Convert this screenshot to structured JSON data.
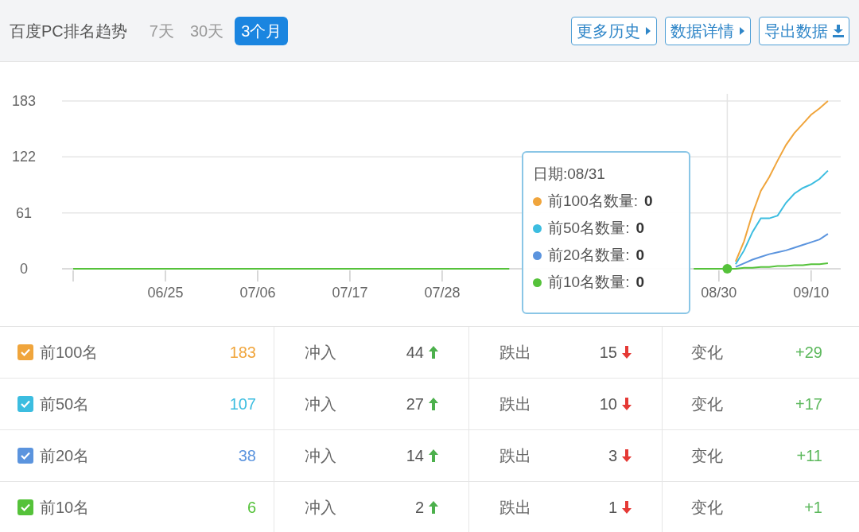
{
  "header": {
    "title": "百度PC排名趋势",
    "ranges": [
      {
        "label": "7天",
        "selected": false
      },
      {
        "label": "30天",
        "selected": false
      },
      {
        "label": "3个月",
        "selected": true
      }
    ],
    "buttons": [
      {
        "label": "更多历史",
        "kind": "more"
      },
      {
        "label": "数据详情",
        "kind": "more"
      },
      {
        "label": "导出数据",
        "kind": "download"
      }
    ]
  },
  "chart": {
    "chart_data": {
      "type": "line",
      "categories": [
        null,
        null,
        null,
        null,
        null,
        null,
        null,
        null,
        null,
        null,
        null,
        "06/25",
        null,
        null,
        null,
        null,
        null,
        null,
        null,
        null,
        null,
        null,
        "07/06",
        null,
        null,
        null,
        null,
        null,
        null,
        null,
        null,
        null,
        null,
        "07/17",
        null,
        null,
        null,
        null,
        null,
        null,
        null,
        null,
        null,
        null,
        "07/28",
        null,
        null,
        null,
        null,
        null,
        null,
        null,
        null,
        null,
        null,
        null,
        null,
        null,
        null,
        null,
        null,
        null,
        null,
        null,
        null,
        null,
        null,
        null,
        null,
        null,
        null,
        null,
        null,
        null,
        null,
        null,
        null,
        "08/30",
        null,
        null,
        null,
        null,
        null,
        null,
        null,
        null,
        null,
        null,
        "09/10",
        null,
        null
      ],
      "ylim": [
        0,
        183
      ],
      "yticks": [
        0,
        61,
        122,
        183
      ],
      "series": [
        {
          "name": "前100名数量",
          "color": "#f0a53c",
          "values": [
            null,
            null,
            null,
            null,
            null,
            null,
            null,
            null,
            null,
            null,
            null,
            null,
            null,
            null,
            null,
            null,
            null,
            null,
            null,
            null,
            null,
            null,
            null,
            null,
            null,
            null,
            null,
            null,
            null,
            null,
            null,
            null,
            null,
            null,
            null,
            null,
            null,
            null,
            null,
            null,
            null,
            null,
            null,
            null,
            null,
            null,
            null,
            null,
            null,
            null,
            null,
            null,
            null,
            null,
            null,
            null,
            null,
            null,
            null,
            null,
            null,
            null,
            null,
            null,
            null,
            null,
            null,
            null,
            null,
            null,
            null,
            null,
            null,
            null,
            null,
            null,
            null,
            null,
            null,
            8,
            30,
            60,
            85,
            100,
            118,
            135,
            148,
            158,
            168,
            175,
            183
          ]
        },
        {
          "name": "前50名数量",
          "color": "#3cbde0",
          "values": [
            null,
            null,
            null,
            null,
            null,
            null,
            null,
            null,
            null,
            null,
            null,
            null,
            null,
            null,
            null,
            null,
            null,
            null,
            null,
            null,
            null,
            null,
            null,
            null,
            null,
            null,
            null,
            null,
            null,
            null,
            null,
            null,
            null,
            null,
            null,
            null,
            null,
            null,
            null,
            null,
            null,
            null,
            null,
            null,
            null,
            null,
            null,
            null,
            null,
            null,
            null,
            null,
            null,
            null,
            null,
            null,
            null,
            null,
            null,
            null,
            null,
            null,
            null,
            null,
            null,
            null,
            null,
            null,
            null,
            null,
            null,
            null,
            null,
            null,
            null,
            null,
            null,
            null,
            null,
            5,
            20,
            40,
            55,
            55,
            58,
            72,
            82,
            88,
            92,
            98,
            107
          ]
        },
        {
          "name": "前20名数量",
          "color": "#5b94de",
          "values": [
            null,
            null,
            null,
            null,
            null,
            null,
            null,
            null,
            null,
            null,
            null,
            null,
            null,
            null,
            null,
            null,
            null,
            null,
            null,
            null,
            null,
            null,
            null,
            null,
            null,
            null,
            null,
            null,
            null,
            null,
            null,
            null,
            null,
            null,
            null,
            null,
            null,
            null,
            null,
            null,
            null,
            null,
            null,
            null,
            null,
            null,
            null,
            null,
            null,
            null,
            null,
            null,
            null,
            null,
            null,
            null,
            null,
            null,
            null,
            null,
            null,
            null,
            null,
            null,
            null,
            null,
            null,
            null,
            null,
            null,
            null,
            null,
            null,
            null,
            null,
            null,
            null,
            null,
            null,
            2,
            6,
            10,
            13,
            16,
            18,
            20,
            23,
            26,
            29,
            32,
            38
          ]
        },
        {
          "name": "前10名数量",
          "color": "#55c23a",
          "values": [
            0,
            0,
            0,
            0,
            0,
            0,
            0,
            0,
            0,
            0,
            0,
            0,
            0,
            0,
            0,
            0,
            0,
            0,
            0,
            0,
            0,
            0,
            0,
            0,
            0,
            0,
            0,
            0,
            0,
            0,
            0,
            0,
            0,
            0,
            0,
            0,
            0,
            0,
            0,
            0,
            0,
            0,
            0,
            0,
            0,
            0,
            0,
            0,
            0,
            0,
            0,
            0,
            0,
            null,
            null,
            null,
            null,
            null,
            null,
            null,
            null,
            null,
            null,
            null,
            null,
            null,
            null,
            null,
            null,
            null,
            null,
            null,
            null,
            null,
            0,
            0,
            0,
            0,
            0,
            0,
            1,
            1,
            2,
            2,
            3,
            3,
            4,
            4,
            5,
            5,
            6
          ]
        }
      ]
    },
    "tooltip": {
      "title": "日期:08/31",
      "separator": ":",
      "values": [
        "0",
        "0",
        "0",
        "0"
      ]
    }
  },
  "rows": [
    {
      "label": "前100名",
      "checked": true,
      "color": "#f0a53c",
      "count": "183",
      "in_label": "冲入",
      "in_value": "44",
      "out_label": "跌出",
      "out_value": "15",
      "change_label": "变化",
      "change": "+29"
    },
    {
      "label": "前50名",
      "checked": true,
      "color": "#3cbde0",
      "count": "107",
      "in_label": "冲入",
      "in_value": "27",
      "out_label": "跌出",
      "out_value": "10",
      "change_label": "变化",
      "change": "+17"
    },
    {
      "label": "前20名",
      "checked": true,
      "color": "#5b94de",
      "count": "38",
      "in_label": "冲入",
      "in_value": "14",
      "out_label": "跌出",
      "out_value": "3",
      "change_label": "变化",
      "change": "+11"
    },
    {
      "label": "前10名",
      "checked": true,
      "color": "#55c23a",
      "count": "6",
      "in_label": "冲入",
      "in_value": "2",
      "out_label": "跌出",
      "out_value": "1",
      "change_label": "变化",
      "change": "+1"
    }
  ]
}
